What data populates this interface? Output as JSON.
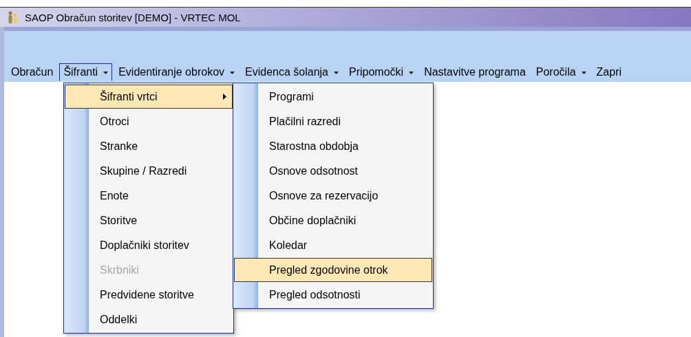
{
  "window": {
    "title": "SAOP Obračun storitev [DEMO] - VRTEC MOL"
  },
  "menubar": [
    {
      "label": "Obračun",
      "dropdown": false,
      "selected": false
    },
    {
      "label": "Šifranti",
      "dropdown": true,
      "selected": true
    },
    {
      "label": "Evidentiranje obrokov",
      "dropdown": true,
      "selected": false
    },
    {
      "label": "Evidenca šolanja",
      "dropdown": true,
      "selected": false
    },
    {
      "label": "Pripomočki",
      "dropdown": true,
      "selected": false
    },
    {
      "label": "Nastavitve programa",
      "dropdown": false,
      "selected": false
    },
    {
      "label": "Poročila",
      "dropdown": true,
      "selected": false
    },
    {
      "label": "Zapri",
      "dropdown": false,
      "selected": false
    }
  ],
  "menu": [
    {
      "label": "Šifranti vrtci",
      "submenu": true,
      "selected": true,
      "disabled": false
    },
    {
      "label": "Otroci",
      "submenu": false,
      "selected": false,
      "disabled": false
    },
    {
      "label": "Stranke",
      "submenu": false,
      "selected": false,
      "disabled": false
    },
    {
      "label": "Skupine / Razredi",
      "submenu": false,
      "selected": false,
      "disabled": false
    },
    {
      "label": "Enote",
      "submenu": false,
      "selected": false,
      "disabled": false
    },
    {
      "label": "Storitve",
      "submenu": false,
      "selected": false,
      "disabled": false
    },
    {
      "label": "Doplačniki storitev",
      "submenu": false,
      "selected": false,
      "disabled": false
    },
    {
      "label": "Skrbniki",
      "submenu": false,
      "selected": false,
      "disabled": true
    },
    {
      "label": "Predvidene storitve",
      "submenu": false,
      "selected": false,
      "disabled": false
    },
    {
      "label": "Oddelki",
      "submenu": false,
      "selected": false,
      "disabled": false
    }
  ],
  "submenu": [
    {
      "label": "Programi",
      "selected": false
    },
    {
      "label": "Plačilni razredi",
      "selected": false
    },
    {
      "label": "Starostna obdobja",
      "selected": false
    },
    {
      "label": "Osnove odsotnost",
      "selected": false
    },
    {
      "label": "Osnove za rezervacijo",
      "selected": false
    },
    {
      "label": "Občine doplačniki",
      "selected": false
    },
    {
      "label": "Koledar",
      "selected": false
    },
    {
      "label": "Pregled zgodovine otrok",
      "selected": true
    },
    {
      "label": "Pregled odsotnosti",
      "selected": false
    }
  ]
}
